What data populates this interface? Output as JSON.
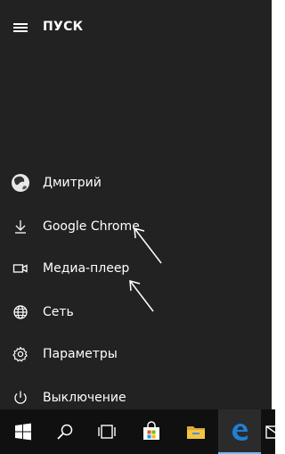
{
  "header": {
    "menu_icon": "hamburger-icon",
    "title": "ПУСК"
  },
  "user": {
    "name": "Дмитрий",
    "icon": "avatar"
  },
  "items": [
    {
      "label": "Google Chrome",
      "icon": "download-icon"
    },
    {
      "label": "Медиа-плеер",
      "icon": "video-camera-icon"
    },
    {
      "label": "Сеть",
      "icon": "globe-icon"
    },
    {
      "label": "Параметры",
      "icon": "gear-icon"
    },
    {
      "label": "Выключение",
      "icon": "power-icon"
    }
  ],
  "taskbar": {
    "icons": [
      "windows-start-icon",
      "search-icon",
      "task-view-icon",
      "store-icon",
      "file-explorer-icon",
      "edge-icon",
      "mail-icon"
    ]
  },
  "colors": {
    "menu_bg": "#222222",
    "taskbar_bg": "#101010",
    "text": "#ffffff",
    "edge_blue": "#1e7fd6",
    "folder_yellow": "#f4c542",
    "windows_blue": "#0078d7"
  }
}
